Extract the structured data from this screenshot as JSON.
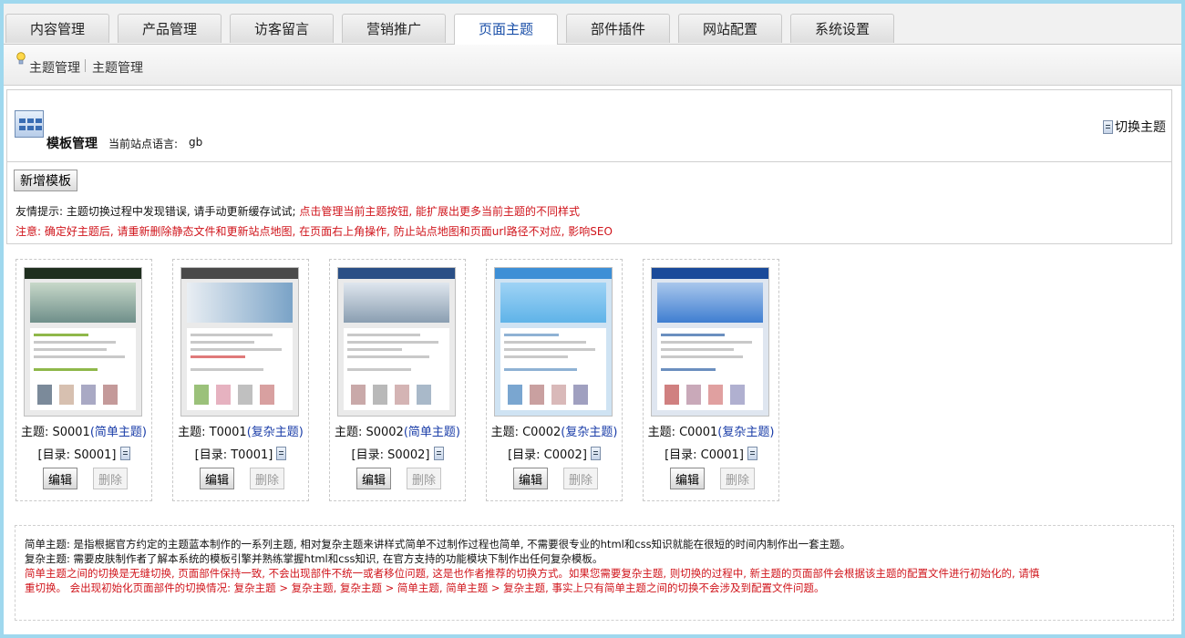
{
  "tabs": [
    {
      "label": "内容管理",
      "active": false
    },
    {
      "label": "产品管理",
      "active": false
    },
    {
      "label": "访客留言",
      "active": false
    },
    {
      "label": "营销推广",
      "active": false
    },
    {
      "label": "页面主题",
      "active": true
    },
    {
      "label": "部件插件",
      "active": false
    },
    {
      "label": "网站配置",
      "active": false
    },
    {
      "label": "系统设置",
      "active": false
    }
  ],
  "breadcrumb": {
    "first": "主题管理",
    "second": "主题管理"
  },
  "panel": {
    "title": "模板管理",
    "lang_label": "当前站点语言:",
    "lang_value": "gb",
    "switch_label": "切换主题",
    "add_button": "新增模板",
    "tip_normal": "友情提示: 主题切换过程中发现错误, 请手动更新缓存试试; ",
    "tip_red": "点击管理当前主题按钮, 能扩展出更多当前主题的不同样式",
    "notice": "注意: 确定好主题后, 请重新删除静态文件和更新站点地图, 在页面右上角操作, 防止站点地图和页面url路径不对应, 影响SEO"
  },
  "themes": [
    {
      "label": "主题: S0001",
      "type": "(简单主题)",
      "dir": "[目录: S0001]",
      "edit": "编辑",
      "delete": "删除",
      "colors": {
        "top": "#1f2f1f",
        "hero": "#6f8f8a",
        "body": "#8fb84a"
      }
    },
    {
      "label": "主题: T0001",
      "type": "(复杂主题)",
      "dir": "[目录: T0001]",
      "edit": "编辑",
      "delete": "删除",
      "colors": {
        "top": "#4a4a4a",
        "hero": "#7aa3c7",
        "body": "#d8d8d8"
      }
    },
    {
      "label": "主题: S0002",
      "type": "(简单主题)",
      "dir": "[目录: S0002]",
      "edit": "编辑",
      "delete": "删除",
      "colors": {
        "top": "#2a4f86",
        "hero": "#8a9eb1",
        "body": "#b9b9b9"
      }
    },
    {
      "label": "主题: C0002",
      "type": "(复杂主题)",
      "dir": "[目录: C0002]",
      "edit": "编辑",
      "delete": "删除",
      "colors": {
        "top": "#3d8fd6",
        "hero": "#5fb3e8",
        "body": "#8fb2d4"
      }
    },
    {
      "label": "主题: C0001",
      "type": "(复杂主题)",
      "dir": "[目录: C0001]",
      "edit": "编辑",
      "delete": "删除",
      "colors": {
        "top": "#1a4a9a",
        "hero": "#3f7ed1",
        "body": "#6b8fbf"
      }
    }
  ],
  "notes": {
    "simple": "简单主题: 是指根据官方约定的主题蓝本制作的一系列主题, 相对复杂主题来讲样式简单不过制作过程也简单, 不需要很专业的html和css知识就能在很短的时间内制作出一套主题。",
    "complex": "复杂主题: 需要皮肤制作者了解本系统的模板引擎并熟练掌握html和css知识, 在官方支持的功能模块下制作出任何复杂模板。",
    "red1": "简单主题之间的切换是无缝切换, 页面部件保持一致, 不会出现部件不统一或者移位问题, 这是也作者推荐的切换方式。如果您需要复杂主题, 则切换的过程中, 新主题的页面部件会根据该主题的配置文件进行初始化的, 请慎",
    "red2": "重切换。 会出现初始化页面部件的切换情况: 复杂主题 > 复杂主题, 复杂主题 > 简单主题, 简单主题 > 复杂主题, 事实上只有简单主题之间的切换不会涉及到配置文件问题。"
  }
}
